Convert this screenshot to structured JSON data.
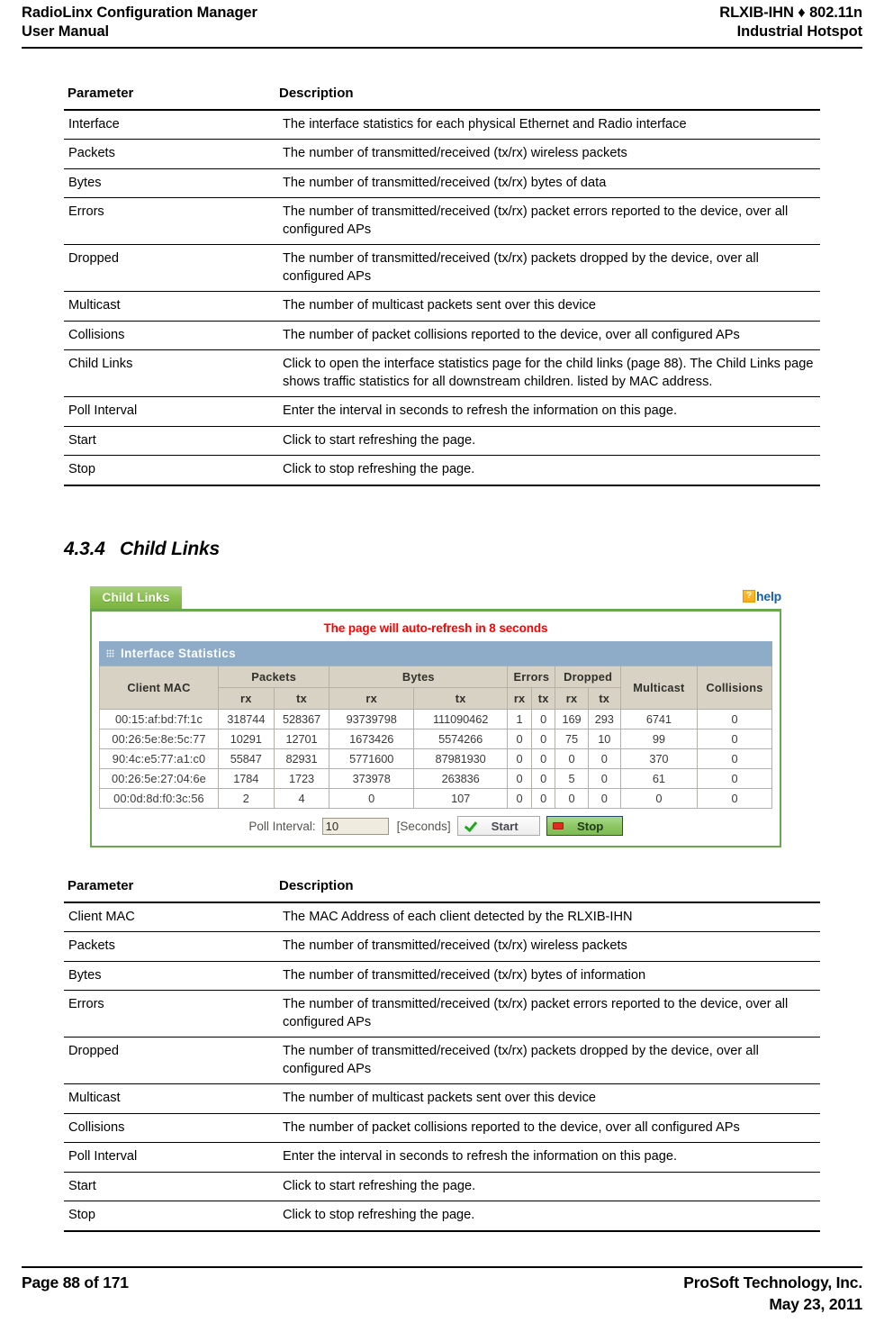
{
  "header": {
    "left_line1": "RadioLinx Configuration Manager",
    "left_line2": "User Manual",
    "right_line1": "RLXIB-IHN ♦ 802.11n",
    "right_line2": "Industrial Hotspot"
  },
  "table1": {
    "col_param": "Parameter",
    "col_desc": "Description",
    "rows": [
      {
        "param": "Interface",
        "desc": "The interface statistics for each physical Ethernet and Radio interface"
      },
      {
        "param": "Packets",
        "desc": "The number of transmitted/received (tx/rx) wireless packets"
      },
      {
        "param": "Bytes",
        "desc": "The number of transmitted/received (tx/rx) bytes of data"
      },
      {
        "param": "Errors",
        "desc": "The number of transmitted/received (tx/rx) packet errors reported to the device, over all configured APs"
      },
      {
        "param": "Dropped",
        "desc": "The number of transmitted/received (tx/rx) packets dropped by the device, over all configured APs"
      },
      {
        "param": "Multicast",
        "desc": "The number of multicast packets sent over this device"
      },
      {
        "param": "Collisions",
        "desc": "The number of packet collisions reported to the device, over all configured APs"
      },
      {
        "param": "Child Links",
        "desc": "Click to open the interface statistics page for the child links (page 88). The Child Links page shows traffic statistics for all downstream children. listed by MAC address."
      },
      {
        "param": "Poll Interval",
        "desc": "Enter the interval in seconds to refresh the information on this page."
      },
      {
        "param": "Start",
        "desc": "Click to start refreshing the page."
      },
      {
        "param": "Stop",
        "desc": "Click to stop refreshing the page."
      }
    ]
  },
  "section": {
    "number": "4.3.4",
    "title": "Child Links"
  },
  "screenshot": {
    "tab_label": "Child Links",
    "help_badge": "?",
    "help_label": "help",
    "refresh_message": "The page will auto-refresh in 8 seconds",
    "panel_title": "Interface Statistics",
    "grip_icon": "grip-icon",
    "colors": {
      "tab_green": "#8cc152",
      "panel_blue": "#8eacc8",
      "header_beige": "#d8d2c4",
      "refresh_red": "#ff0000",
      "help_yellow": "#f9a825",
      "help_link_blue": "#1a5fa8",
      "border_green": "#6aa84f"
    },
    "stats": {
      "group_headers": {
        "client_mac": "Client MAC",
        "packets": "Packets",
        "bytes": "Bytes",
        "errors": "Errors",
        "dropped": "Dropped",
        "multicast": "Multicast",
        "collisions": "Collisions"
      },
      "sub_headers": {
        "packets_rx": "rx",
        "packets_tx": "tx",
        "bytes_rx": "rx",
        "bytes_tx": "tx",
        "errors_rx": "rx",
        "errors_tx": "tx",
        "dropped_rx": "rx",
        "dropped_tx": "tx"
      },
      "rows": [
        {
          "mac": "00:15:af:bd:7f:1c",
          "packets_rx": "318744",
          "packets_tx": "528367",
          "bytes_rx": "93739798",
          "bytes_tx": "111090462",
          "errors_rx": "1",
          "errors_tx": "0",
          "dropped_rx": "169",
          "dropped_tx": "293",
          "multicast": "6741",
          "collisions": "0"
        },
        {
          "mac": "00:26:5e:8e:5c:77",
          "packets_rx": "10291",
          "packets_tx": "12701",
          "bytes_rx": "1673426",
          "bytes_tx": "5574266",
          "errors_rx": "0",
          "errors_tx": "0",
          "dropped_rx": "75",
          "dropped_tx": "10",
          "multicast": "99",
          "collisions": "0"
        },
        {
          "mac": "90:4c:e5:77:a1:c0",
          "packets_rx": "55847",
          "packets_tx": "82931",
          "bytes_rx": "5771600",
          "bytes_tx": "87981930",
          "errors_rx": "0",
          "errors_tx": "0",
          "dropped_rx": "0",
          "dropped_tx": "0",
          "multicast": "370",
          "collisions": "0"
        },
        {
          "mac": "00:26:5e:27:04:6e",
          "packets_rx": "1784",
          "packets_tx": "1723",
          "bytes_rx": "373978",
          "bytes_tx": "263836",
          "errors_rx": "0",
          "errors_tx": "0",
          "dropped_rx": "5",
          "dropped_tx": "0",
          "multicast": "61",
          "collisions": "0"
        },
        {
          "mac": "00:0d:8d:f0:3c:56",
          "packets_rx": "2",
          "packets_tx": "4",
          "bytes_rx": "0",
          "bytes_tx": "107",
          "errors_rx": "0",
          "errors_tx": "0",
          "dropped_rx": "0",
          "dropped_tx": "0",
          "multicast": "0",
          "collisions": "0"
        }
      ]
    },
    "poll": {
      "label": "Poll Interval:",
      "value": "10",
      "units": "[Seconds]",
      "start_label": "Start",
      "stop_label": "Stop"
    }
  },
  "table2": {
    "col_param": "Parameter",
    "col_desc": "Description",
    "rows": [
      {
        "param": "Client MAC",
        "desc": "The MAC Address of each client detected by the RLXIB-IHN"
      },
      {
        "param": "Packets",
        "desc": "The number of transmitted/received (tx/rx) wireless packets"
      },
      {
        "param": "Bytes",
        "desc": "The number of transmitted/received (tx/rx) bytes of information"
      },
      {
        "param": "Errors",
        "desc": "The number of transmitted/received (tx/rx) packet errors reported to the device, over all configured APs"
      },
      {
        "param": "Dropped",
        "desc": "The number of transmitted/received (tx/rx) packets dropped by the device, over all configured APs"
      },
      {
        "param": "Multicast",
        "desc": "The number of multicast packets sent over this device"
      },
      {
        "param": "Collisions",
        "desc": "The number of packet collisions reported to the device, over all configured APs"
      },
      {
        "param": "Poll Interval",
        "desc": "Enter the interval in seconds to refresh the information on this page."
      },
      {
        "param": "Start",
        "desc": "Click to start refreshing the page."
      },
      {
        "param": "Stop",
        "desc": "Click to stop refreshing the page."
      }
    ]
  },
  "footer": {
    "page_label": "Page 88 of 171",
    "company": "ProSoft Technology, Inc.",
    "date": "May 23, 2011"
  }
}
